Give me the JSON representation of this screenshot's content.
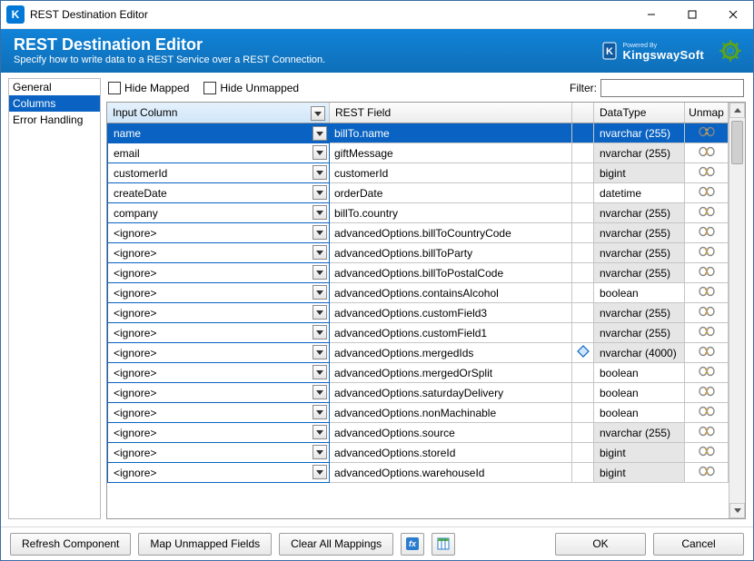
{
  "titlebar": {
    "title": "REST Destination Editor",
    "app_icon_letter": "K"
  },
  "banner": {
    "heading": "REST Destination Editor",
    "sub": "Specify how to write data to a REST Service over a REST Connection.",
    "powered_by": "Powered By",
    "brand": "KingswaySoft"
  },
  "nav": {
    "items": [
      "General",
      "Columns",
      "Error Handling"
    ],
    "selected": 1
  },
  "toolbar": {
    "hide_mapped": "Hide Mapped",
    "hide_unmapped": "Hide Unmapped",
    "filter_label": "Filter:",
    "filter_value": ""
  },
  "grid": {
    "headers": {
      "input": "Input Column",
      "field": "REST Field",
      "datatype": "DataType",
      "unmap": "Unmap"
    },
    "rows": [
      {
        "input": "name",
        "field": "billTo.name",
        "datatype": "nvarchar (255)",
        "dt_shaded": true,
        "selected": true,
        "icon": ""
      },
      {
        "input": "email",
        "field": "giftMessage",
        "datatype": "nvarchar (255)",
        "dt_shaded": true,
        "selected": false,
        "icon": ""
      },
      {
        "input": "customerId",
        "field": "customerId",
        "datatype": "bigint",
        "dt_shaded": true,
        "selected": false,
        "icon": ""
      },
      {
        "input": "createDate",
        "field": "orderDate",
        "datatype": "datetime",
        "dt_shaded": false,
        "selected": false,
        "icon": ""
      },
      {
        "input": "company",
        "field": "billTo.country",
        "datatype": "nvarchar (255)",
        "dt_shaded": true,
        "selected": false,
        "icon": ""
      },
      {
        "input": "<ignore>",
        "field": "advancedOptions.billToCountryCode",
        "datatype": "nvarchar (255)",
        "dt_shaded": true,
        "selected": false,
        "icon": ""
      },
      {
        "input": "<ignore>",
        "field": "advancedOptions.billToParty",
        "datatype": "nvarchar (255)",
        "dt_shaded": true,
        "selected": false,
        "icon": ""
      },
      {
        "input": "<ignore>",
        "field": "advancedOptions.billToPostalCode",
        "datatype": "nvarchar (255)",
        "dt_shaded": true,
        "selected": false,
        "icon": ""
      },
      {
        "input": "<ignore>",
        "field": "advancedOptions.containsAlcohol",
        "datatype": "boolean",
        "dt_shaded": false,
        "selected": false,
        "icon": ""
      },
      {
        "input": "<ignore>",
        "field": "advancedOptions.customField3",
        "datatype": "nvarchar (255)",
        "dt_shaded": true,
        "selected": false,
        "icon": ""
      },
      {
        "input": "<ignore>",
        "field": "advancedOptions.customField1",
        "datatype": "nvarchar (255)",
        "dt_shaded": true,
        "selected": false,
        "icon": ""
      },
      {
        "input": "<ignore>",
        "field": "advancedOptions.mergedIds",
        "datatype": "nvarchar (4000)",
        "dt_shaded": true,
        "selected": false,
        "icon": "diamond"
      },
      {
        "input": "<ignore>",
        "field": "advancedOptions.mergedOrSplit",
        "datatype": "boolean",
        "dt_shaded": false,
        "selected": false,
        "icon": ""
      },
      {
        "input": "<ignore>",
        "field": "advancedOptions.saturdayDelivery",
        "datatype": "boolean",
        "dt_shaded": false,
        "selected": false,
        "icon": ""
      },
      {
        "input": "<ignore>",
        "field": "advancedOptions.nonMachinable",
        "datatype": "boolean",
        "dt_shaded": false,
        "selected": false,
        "icon": ""
      },
      {
        "input": "<ignore>",
        "field": "advancedOptions.source",
        "datatype": "nvarchar (255)",
        "dt_shaded": true,
        "selected": false,
        "icon": ""
      },
      {
        "input": "<ignore>",
        "field": "advancedOptions.storeId",
        "datatype": "bigint",
        "dt_shaded": true,
        "selected": false,
        "icon": ""
      },
      {
        "input": "<ignore>",
        "field": "advancedOptions.warehouseId",
        "datatype": "bigint",
        "dt_shaded": true,
        "selected": false,
        "icon": ""
      }
    ]
  },
  "footer": {
    "refresh": "Refresh Component",
    "map_unmapped": "Map Unmapped Fields",
    "clear_all": "Clear All Mappings",
    "ok": "OK",
    "cancel": "Cancel"
  }
}
